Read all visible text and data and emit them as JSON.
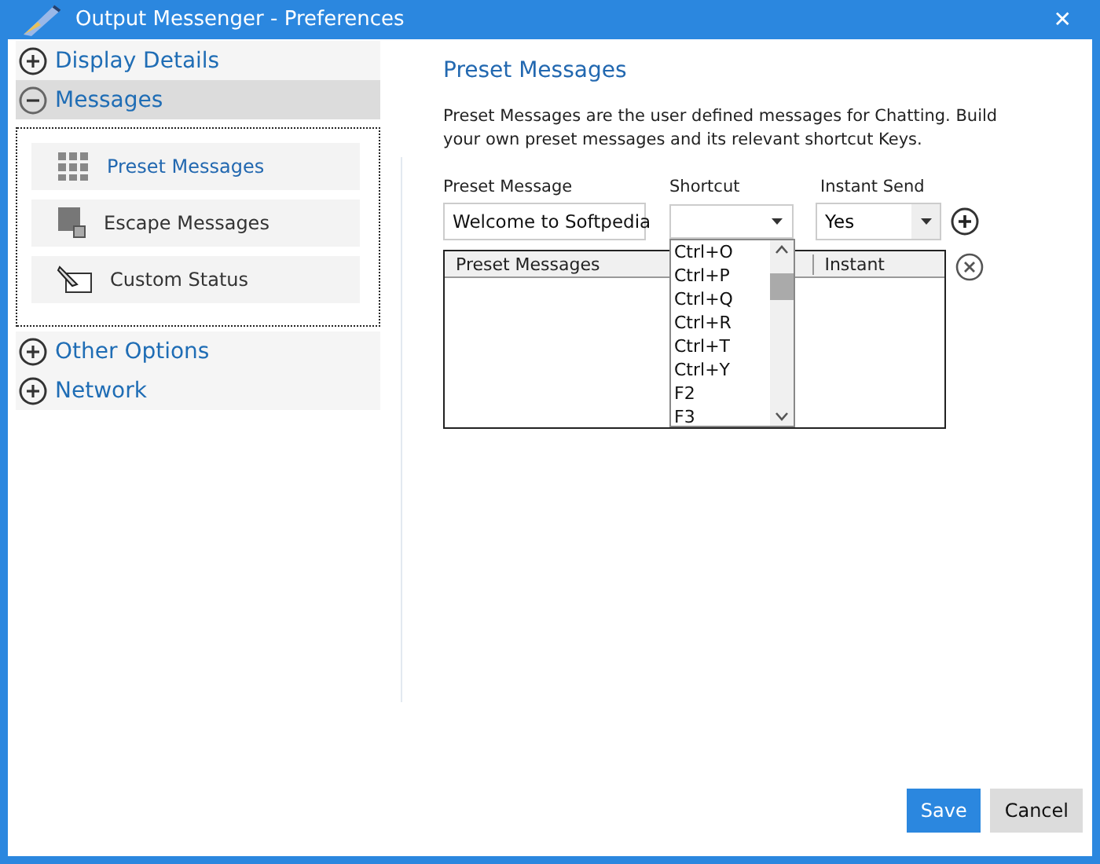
{
  "window": {
    "title": "Output Messenger - Preferences",
    "close": "✕"
  },
  "sidebar": {
    "groups": [
      {
        "label": "Display Details",
        "expanded": false,
        "selected": false
      },
      {
        "label": "Messages",
        "expanded": true,
        "selected": true,
        "children": [
          {
            "label": "Preset Messages"
          },
          {
            "label": "Escape Messages"
          },
          {
            "label": "Custom Status"
          }
        ]
      },
      {
        "label": "Other Options",
        "expanded": false,
        "selected": false
      },
      {
        "label": "Network",
        "expanded": false,
        "selected": false
      }
    ]
  },
  "panel": {
    "title": "Preset Messages",
    "description": "Preset Messages are the user defined messages for Chatting. Build your own preset messages and its relevant shortcut Keys.",
    "fields": {
      "message_label": "Preset Message",
      "message_value": "Welcome to Softpedia",
      "shortcut_label": "Shortcut",
      "instant_label": "Instant Send",
      "instant_value": "Yes"
    },
    "shortcut_list": {
      "open": true,
      "options": [
        "Ctrl+O",
        "Ctrl+P",
        "Ctrl+Q",
        "Ctrl+R",
        "Ctrl+T",
        "Ctrl+Y",
        "F2",
        "F3"
      ]
    },
    "table": {
      "columns": [
        "Preset Messages",
        "Instant"
      ]
    }
  },
  "buttons": [
    {
      "label": "Save",
      "kind": "primary"
    },
    {
      "label": "Cancel",
      "kind": "secondary"
    }
  ]
}
